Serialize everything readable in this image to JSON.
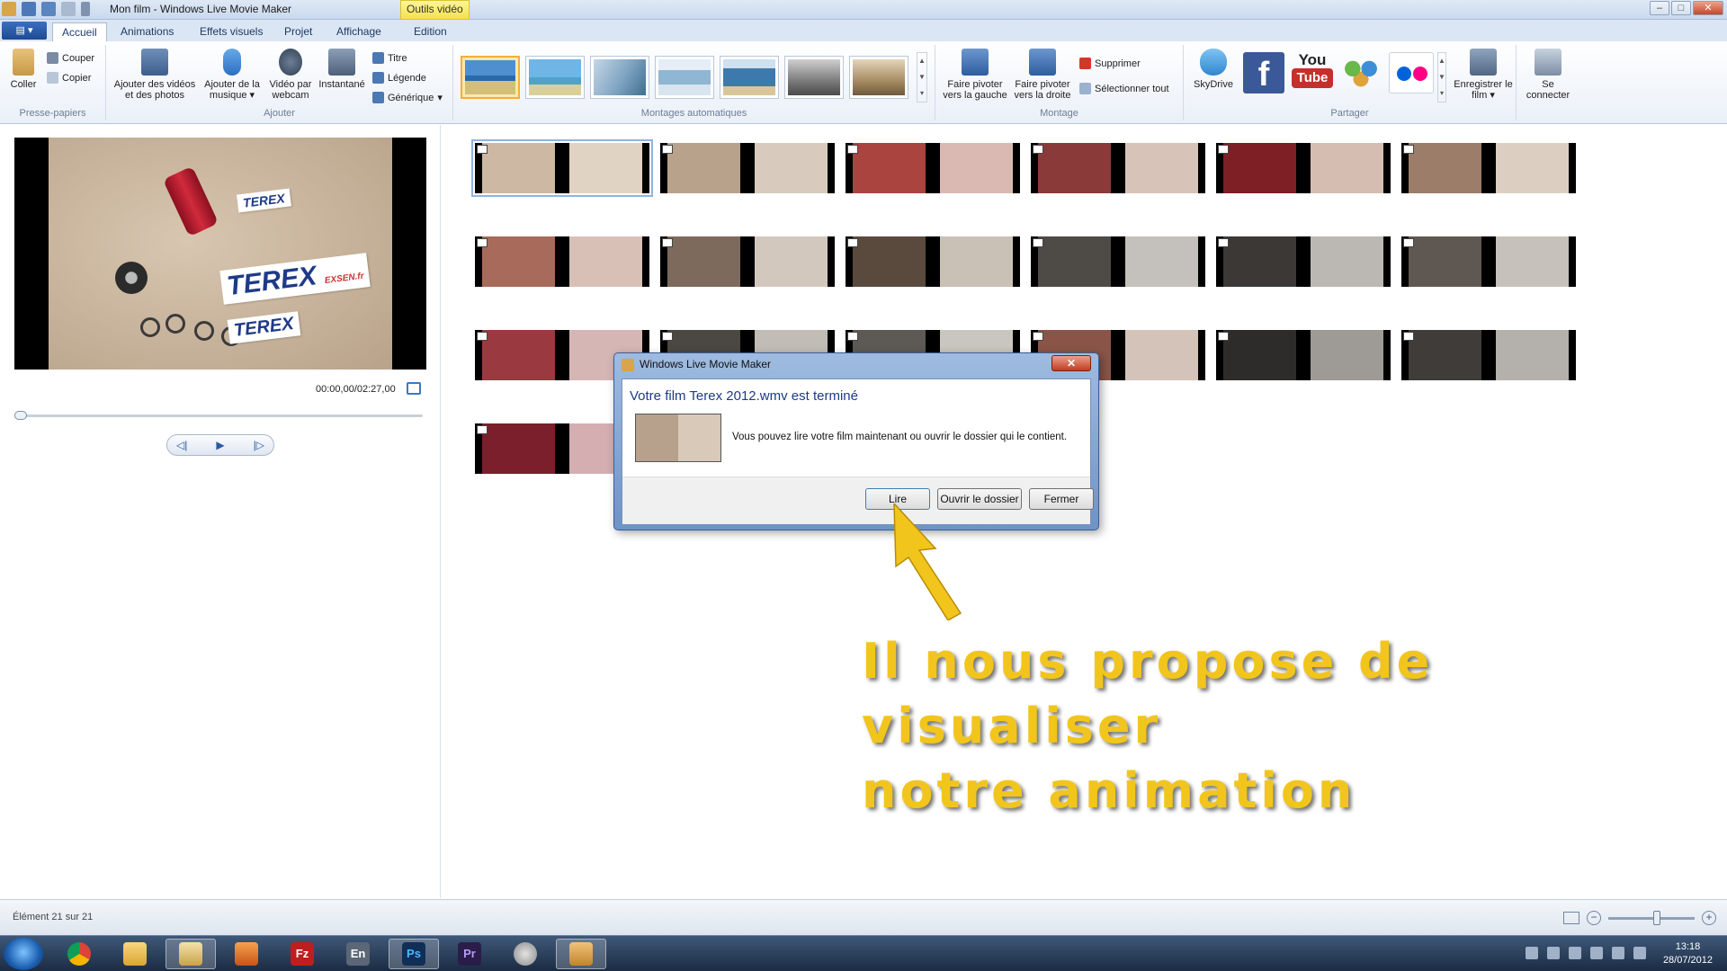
{
  "window": {
    "title": "Mon film - Windows Live Movie Maker",
    "context_tab": "Outils vidéo"
  },
  "tabs": [
    "Accueil",
    "Animations",
    "Effets visuels",
    "Projet",
    "Affichage",
    "Edition"
  ],
  "ribbon": {
    "clipboard": {
      "paste": "Coller",
      "cut": "Couper",
      "copy": "Copier",
      "label": "Presse-papiers"
    },
    "add": {
      "add_videos": "Ajouter des vidéos et des photos",
      "add_music": "Ajouter de la musique",
      "webcam": "Vidéo par webcam",
      "snapshot": "Instantané",
      "title": "Titre",
      "caption": "Légende",
      "credits": "Générique",
      "label": "Ajouter"
    },
    "automovie": {
      "label": "Montages automatiques"
    },
    "editing": {
      "rotate_left": "Faire pivoter vers la gauche",
      "rotate_right": "Faire pivoter vers la droite",
      "delete": "Supprimer",
      "select_all": "Sélectionner tout",
      "label": "Montage"
    },
    "share": {
      "skydrive": "SkyDrive",
      "youtube_you": "You",
      "youtube_tube": "Tube",
      "save_movie": "Enregistrer le film",
      "sign_in": "Se connecter",
      "label": "Partager"
    }
  },
  "preview": {
    "timecode": "00:00,00/02:27,00",
    "label_texts": [
      "TEREX",
      "EXSEN.fr",
      "TEREX"
    ]
  },
  "dialog": {
    "title": "Windows Live Movie Maker",
    "heading": "Votre film Terex 2012.wmv est terminé",
    "message": "Vous pouvez lire votre film maintenant ou ouvrir le dossier qui le contient.",
    "play_button": "Lire",
    "open_folder_button": "Ouvrir le dossier",
    "close_button": "Fermer"
  },
  "annotation": {
    "line1": "Il nous propose de visualiser",
    "line2": "notre animation",
    "color": "#f2c51c"
  },
  "status": {
    "element_count": "Élément 21 sur 21",
    "zoom_out": "−",
    "zoom_in": "+"
  },
  "taskbar": {
    "apps": [
      "chrome-icon",
      "explorer-icon",
      "file-manager-icon",
      "media-player-icon",
      "filezilla-icon",
      "en-icon",
      "photoshop-icon",
      "premiere-icon",
      "paint-icon",
      "movie-maker-icon"
    ],
    "labels": {
      "filezilla": "Fz",
      "en": "En",
      "photoshop": "Ps",
      "premiere": "Pr"
    },
    "time": "13:18",
    "date": "28/07/2012"
  }
}
